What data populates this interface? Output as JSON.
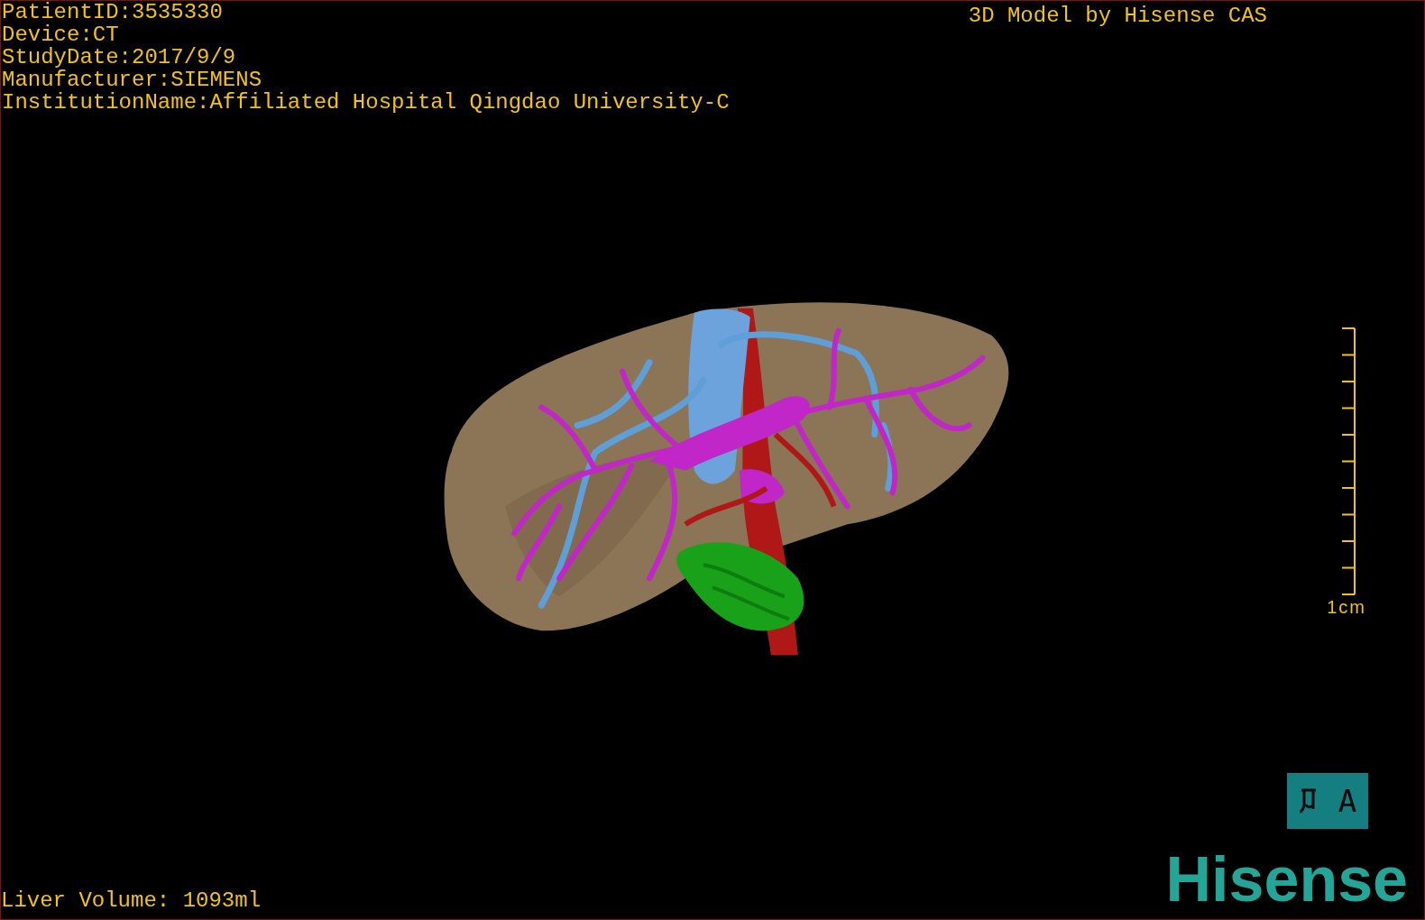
{
  "study_info": [
    "PatientID:3535330",
    "Device:CT",
    "StudyDate:2017/9/9",
    "Manufacturer:SIEMENS",
    "InstitutionName:Affiliated Hospital Qingdao University-C"
  ],
  "title": "3D Model by Hisense CAS",
  "scale_bar": {
    "label": "1cm"
  },
  "liver_volume": "Liver Volume: 1093ml",
  "orientation_cube": {
    "label": "A"
  },
  "logo": "Hisense"
}
